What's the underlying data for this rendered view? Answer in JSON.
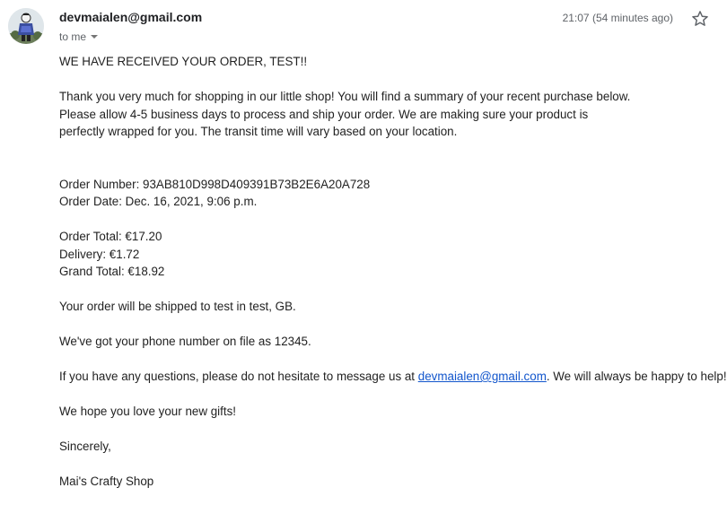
{
  "header": {
    "sender": "devmaialen@gmail.com",
    "recipient": "to me",
    "timestamp": "21:07 (54 minutes ago)",
    "star_icon": "star-outline-icon",
    "avatar_icon": "avatar-figure-icon"
  },
  "body": {
    "greeting": "WE HAVE RECEIVED YOUR ORDER, TEST!!",
    "intro_line1": "Thank you very much for shopping in our little shop! You will find a summary of your recent purchase below.",
    "intro_line2": "Please allow 4-5 business days to process and ship your order. We are making sure your product is",
    "intro_line3": "perfectly wrapped for you. The transit time will vary based on your location.",
    "order_number": "Order Number: 93AB810D998D409391B73B2E6A20A728",
    "order_date": "Order Date: Dec. 16, 2021, 9:06 p.m.",
    "order_total": "Order Total: €17.20",
    "delivery": "Delivery: €1.72",
    "grand_total": "Grand Total: €18.92",
    "shipping": "Your order will be shipped to test in test, GB.",
    "phone": "We've got your phone number on file as 12345.",
    "questions_before": "If you have any questions, please do not hesitate to message us at ",
    "questions_link": "devmaialen@gmail.com",
    "questions_after": ". We will always be happy to help!",
    "hope": "We hope you love your new gifts!",
    "closing": "Sincerely,",
    "signature": "Mai's Crafty Shop"
  },
  "colors": {
    "link": "#1155cc",
    "text": "#222222",
    "muted": "#5f6368"
  }
}
